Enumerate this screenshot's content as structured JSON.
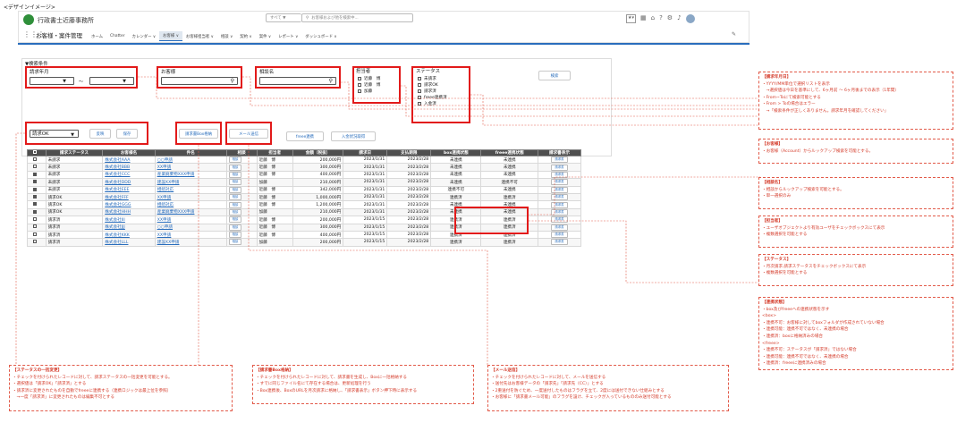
{
  "caption": "<デザインイメージ>",
  "org_name": "行政書士近藤事務所",
  "app_name": "お客様・案件管理",
  "global_search": {
    "scope": "すべて ▼",
    "placeholder": "お客様および他を検索中..."
  },
  "nav_items": [
    "ホーム",
    "Chatter",
    "カレンダー ∨",
    "お客様 ∨",
    "お客様担当者 ∨",
    "相談 ∨",
    "契約 ∨",
    "案件 ∨",
    "レポート ∨",
    "ダッシュボード ∨"
  ],
  "nav_active_index": 3,
  "filter": {
    "section_title": "▼検索条件",
    "billing_month_label": "請求年月",
    "tilde": "〜",
    "customer_label": "お客様",
    "consult_label": "相談名",
    "owner_label": "担当者",
    "owners": [
      "近藤　博",
      "近藤　博",
      "加藤"
    ],
    "status_label": "ステータス",
    "statuses": [
      "未請求",
      "請求OK",
      "請求済",
      "freee連携済",
      "入金済"
    ],
    "search_button": "検索"
  },
  "actions": {
    "status_select": "請求OK",
    "approve_button": "反映",
    "save_button": "保存",
    "box_button": "請求書Box格納",
    "mail_button": "メール送信",
    "freee_button": "freee連携",
    "payment_button": "入金状況取得"
  },
  "table": {
    "headers": [
      "請求ステータス",
      "お客様名",
      "件名",
      "相談",
      "担当者",
      "金額（税抜）",
      "請求日",
      "支払期限",
      "box連携状態",
      "freee連携状態",
      "請求書表示"
    ],
    "consult_link": "相談",
    "invoice_link": "請求書",
    "rows": [
      {
        "checked": false,
        "status": "未請求",
        "customer": "株式会社AAA",
        "subject": "○○申請",
        "owner": "近藤　博",
        "amount": "200,000円",
        "bill": "2023/1/31",
        "due": "2023/2/28",
        "box": "未連携",
        "freee": "未連携"
      },
      {
        "checked": false,
        "status": "未請求",
        "customer": "株式会社BBB",
        "subject": "XX申請",
        "owner": "近藤　博",
        "amount": "300,000円",
        "bill": "2023/1/31",
        "due": "2023/2/28",
        "box": "未連携",
        "freee": "未連携"
      },
      {
        "checked": true,
        "status": "未請求",
        "customer": "株式会社CCC",
        "subject": "産業廃棄物XXX申請",
        "owner": "近藤　博",
        "amount": "400,000円",
        "bill": "2023/1/31",
        "due": "2023/2/28",
        "box": "未連携",
        "freee": "未連携"
      },
      {
        "checked": true,
        "status": "未請求",
        "customer": "株式会社DDD",
        "subject": "建設XX申請",
        "owner": "加藤",
        "amount": "210,000円",
        "bill": "2023/1/31",
        "due": "2023/2/28",
        "box": "未連携",
        "freee": "連携不可"
      },
      {
        "checked": true,
        "status": "未請求",
        "customer": "株式会社EEE",
        "subject": "相続対応",
        "owner": "近藤　博",
        "amount": "342,000円",
        "bill": "2023/1/31",
        "due": "2023/2/28",
        "box": "連携不可",
        "freee": "未連携"
      },
      {
        "checked": true,
        "status": "請求OK",
        "customer": "株式会社FFF",
        "subject": "XX申請",
        "owner": "近藤　博",
        "amount": "1,000,000円",
        "bill": "2023/1/31",
        "due": "2023/2/28",
        "box": "連携済",
        "freee": "連携済"
      },
      {
        "checked": true,
        "status": "請求OK",
        "customer": "株式会社GGG",
        "subject": "相続対応",
        "owner": "近藤　博",
        "amount": "1,200,000円",
        "bill": "2023/1/31",
        "due": "2023/2/28",
        "box": "未連携",
        "freee": "未連携"
      },
      {
        "checked": true,
        "status": "請求OK",
        "customer": "株式会社HHH",
        "subject": "産業廃棄物XXX申請",
        "owner": "加藤",
        "amount": "210,000円",
        "bill": "2023/1/31",
        "due": "2023/2/28",
        "box": "未連携",
        "freee": "未連携"
      },
      {
        "checked": false,
        "status": "請求済",
        "customer": "株式会社III",
        "subject": "XX申請",
        "owner": "近藤　博",
        "amount": "200,000円",
        "bill": "2023/1/15",
        "due": "2023/2/28",
        "box": "連携済",
        "freee": "連携済"
      },
      {
        "checked": false,
        "status": "請求済",
        "customer": "株式会社JJJ",
        "subject": "○○申請",
        "owner": "近藤　博",
        "amount": "300,000円",
        "bill": "2023/1/15",
        "due": "2023/2/28",
        "box": "連携済",
        "freee": "連携済"
      },
      {
        "checked": false,
        "status": "請求済",
        "customer": "株式会社KKK",
        "subject": "XX申請",
        "owner": "近藤　博",
        "amount": "400,000円",
        "bill": "2023/1/15",
        "due": "2023/2/28",
        "box": "連携済",
        "freee": "連携済"
      },
      {
        "checked": false,
        "status": "請求済",
        "customer": "株式会社LLL",
        "subject": "建設XX申請",
        "owner": "加藤",
        "amount": "200,000円",
        "bill": "2023/1/15",
        "due": "2023/2/28",
        "box": "連携済",
        "freee": "連携済"
      }
    ]
  },
  "notes": {
    "billing_month": [
      "【請求年月日】",
      "・YYYY/MM単位で選択リストを表示",
      "　→選択値は今日を基準にして、6ヶ月前 ～ 6ヶ月後までの表示（1年間）",
      "・From~Toにて検索可能とする",
      "・From > Toの場合はエラー",
      "　→「検索条件が正しくありません。請求年月を確認してください」"
    ],
    "customer": [
      "【お客様】",
      "・お客様（Account）からルックアップ検索を可能とする。"
    ],
    "consult": [
      "【相談名】",
      "・相談からルックアップ検索を可能とする。",
      "・単一選択のみ"
    ],
    "owner": [
      "【担当者】",
      "・ユーザオブジェクトより有効ユーザをチェックボックスにて表示",
      "・複数選択を可能とする"
    ],
    "status": [
      "【ステータス】",
      "・月次請求.請求ステータスをチェックボックスにて表示",
      "・複数選択を可能とする"
    ],
    "link": [
      "【連携状態】",
      "・box及びfreeeへの連携状態を示す",
      "<box>",
      "・連携不可：お客様に対してboxフォルダが作成されていない場合",
      "・連携可能：連携不可ではなく、未連携の場合",
      "・連携済：boxに格納済みの場合",
      "<freee>",
      "・連携不可：ステータスが「請求済」ではない場合",
      "・連携可能：連携不可ではなく、未連携の場合",
      "・連携済：freeeに連携済みの場合"
    ],
    "bulk_status": [
      "【ステータスの一括変更】",
      "・チェックを付けられたレコードに対して、請求ステータスの一括変更を可能とする。",
      "・選択値は「請求OK」「請求済」とする",
      "・請求済に変更されたものを自動でfreeeに連携する（連携ロジックは最上位を参照）",
      "　→一度「請求済」に変更されたものは編集不可とする"
    ],
    "box_store": [
      "【請求書Box格納】",
      "・チェックを付けられたレコードに対して、請求書を生成し、Boxに一括格納する",
      "・すでに同じファイル名にて存在する場合は、更新処理を行う",
      "・Box連携後、BoxのURLを月次請求に格納し、「請求書表示」ボタン押下時に表示する"
    ],
    "mail": [
      "【メール送信】",
      "・チェックを付けられたレコードに対して、メールを送信する",
      "・送付先はお客様データの「請求先」「請求先（CC）」とする",
      "・2重送付を防ぐため、一度送付したものはフラグを立て、2度には送付できない仕組みとする",
      "・お客様に「請求書メール可能」のフラグを設け、チェックが入っているもののみ送付可能とする"
    ]
  },
  "colors": {
    "accent": "#2a6ebd",
    "annotation": "#e21a1a",
    "table_header": "#4f4f4f"
  }
}
